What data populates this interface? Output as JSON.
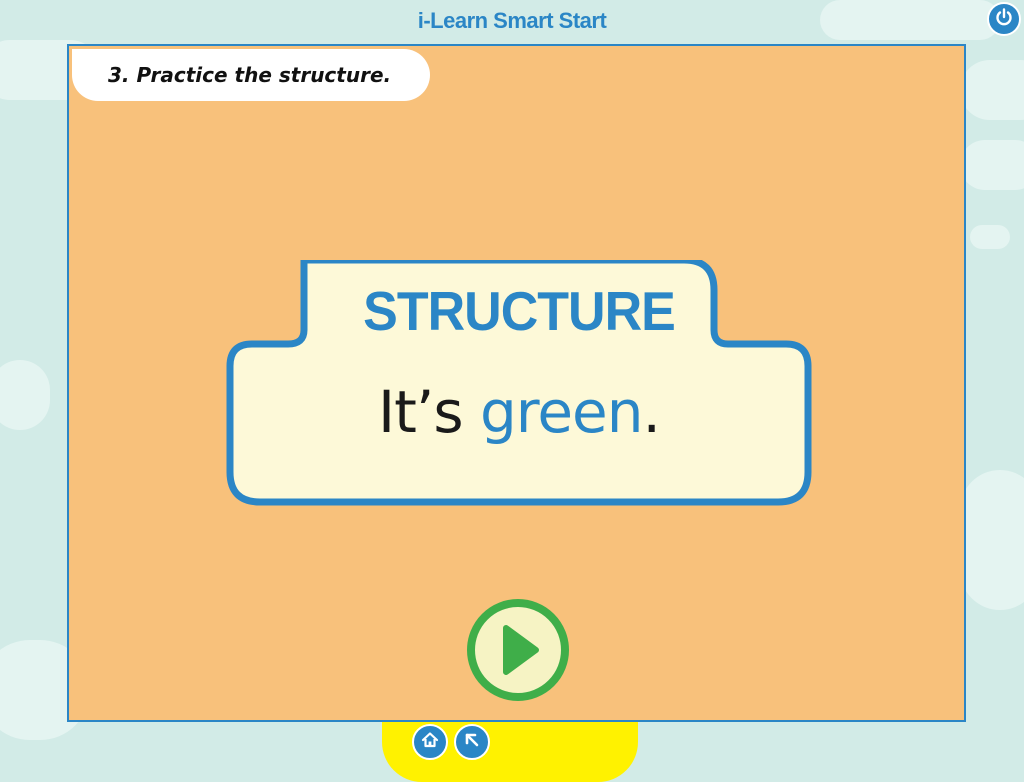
{
  "app": {
    "title": "i-Learn Smart Start"
  },
  "instruction": {
    "text": "3. Practice the structure."
  },
  "card": {
    "heading": "STRUCTURE",
    "sentence_prefix": "It’s ",
    "sentence_highlight": "green",
    "sentence_suffix": "."
  },
  "icons": {
    "power": "power-icon",
    "play": "play-icon",
    "home": "home-icon",
    "back": "back-arrow-icon"
  },
  "colors": {
    "accent_blue": "#2b86c6",
    "panel_orange": "#f8c17b",
    "card_cream": "#fdf9d8",
    "play_green": "#3fae49",
    "bar_yellow": "#fff200"
  }
}
